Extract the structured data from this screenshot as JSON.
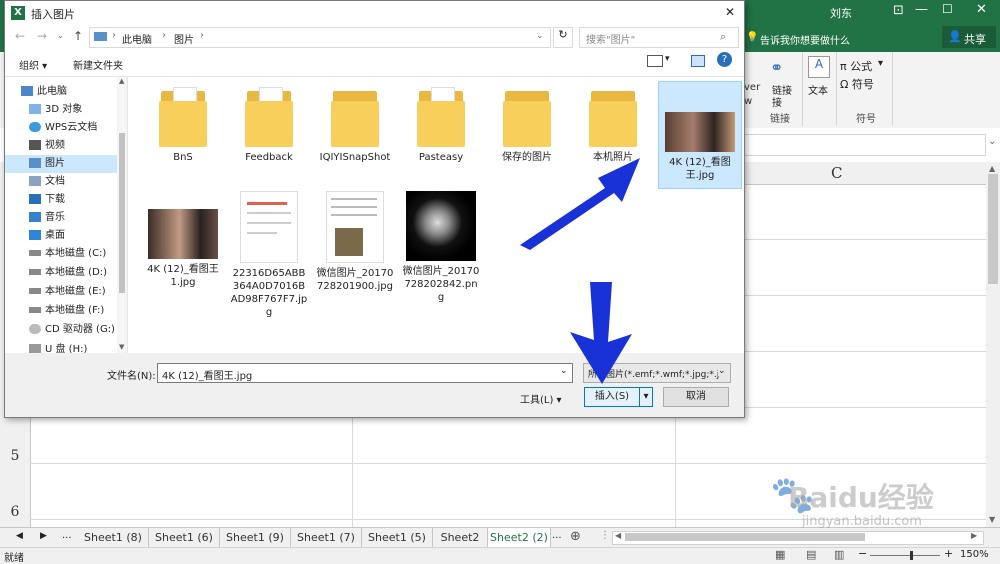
{
  "excel": {
    "user_name": "刘东",
    "tell_me": "告诉我你想要做什么",
    "share": "共享",
    "ribbon_groups": {
      "view_partial": "ver\nw",
      "link_label": "链接",
      "link_group": "链接",
      "text_label": "文本",
      "formula_label": "π 公式",
      "symbol_label": "Ω 符号",
      "symbol_group": "符号"
    },
    "column_header_c": "C",
    "row_numbers": [
      "5",
      "6"
    ],
    "sheet_tabs": [
      "Sheet1 (8)",
      "Sheet1 (6)",
      "Sheet1 (9)",
      "Sheet1 (7)",
      "Sheet1 (5)",
      "Sheet2",
      "Sheet2 (2)"
    ],
    "tab_more": "...",
    "tab_ellipsis": "...",
    "status_ready": "就绪",
    "zoom": "150%",
    "watermark_brand": "Baidu经验",
    "watermark_url": "jingyan.baidu.com"
  },
  "dialog": {
    "title": "插入图片",
    "close_glyph": "✕",
    "breadcrumb": [
      "此电脑",
      "图片"
    ],
    "search_placeholder": "搜索\"图片\"",
    "organize": "组织 ▾",
    "new_folder": "新建文件夹",
    "tree": [
      {
        "label": "此电脑",
        "icon": "pc-icon"
      },
      {
        "label": "3D 对象",
        "icon": "cube-icon"
      },
      {
        "label": "WPS云文档",
        "icon": "cloud-icon"
      },
      {
        "label": "视频",
        "icon": "video-icon"
      },
      {
        "label": "图片",
        "icon": "pictures-icon",
        "selected": true
      },
      {
        "label": "文档",
        "icon": "document-icon"
      },
      {
        "label": "下载",
        "icon": "download-icon"
      },
      {
        "label": "音乐",
        "icon": "music-icon"
      },
      {
        "label": "桌面",
        "icon": "desktop-icon"
      },
      {
        "label": "本地磁盘 (C:)",
        "icon": "drive-icon"
      },
      {
        "label": "本地磁盘 (D:)",
        "icon": "drive-icon"
      },
      {
        "label": "本地磁盘 (E:)",
        "icon": "drive-icon"
      },
      {
        "label": "本地磁盘 (F:)",
        "icon": "drive-icon"
      },
      {
        "label": "CD 驱动器 (G:)",
        "icon": "cd-icon"
      },
      {
        "label": "U 盘 (H:)",
        "icon": "usb-icon"
      }
    ],
    "files": [
      {
        "name": "BnS",
        "kind": "folder"
      },
      {
        "name": "Feedback",
        "kind": "folder"
      },
      {
        "name": "IQIYISnapShot",
        "kind": "folder"
      },
      {
        "name": "Pasteasy",
        "kind": "folder"
      },
      {
        "name": "保存的图片",
        "kind": "folder"
      },
      {
        "name": "本机照片",
        "kind": "folder"
      },
      {
        "name": "4K (12)_看图王.jpg",
        "kind": "image",
        "selected": true
      },
      {
        "name": "4K (12)_看图王1.jpg",
        "kind": "image"
      },
      {
        "name": "22316D65ABB364A0D7016BAD98F767F7.jpg",
        "kind": "image"
      },
      {
        "name": "微信图片_20170728201900.jpg",
        "kind": "image"
      },
      {
        "name": "微信图片_20170728202842.png",
        "kind": "image"
      }
    ],
    "filename_label": "文件名(N):",
    "filename_value": "4K (12)_看图王.jpg",
    "filetype_value": "所有图片(*.emf;*.wmf;*.jpg;*.j",
    "tools_label": "工具(L)  ▾",
    "insert_label": "插入(S)",
    "cancel_label": "取消"
  }
}
